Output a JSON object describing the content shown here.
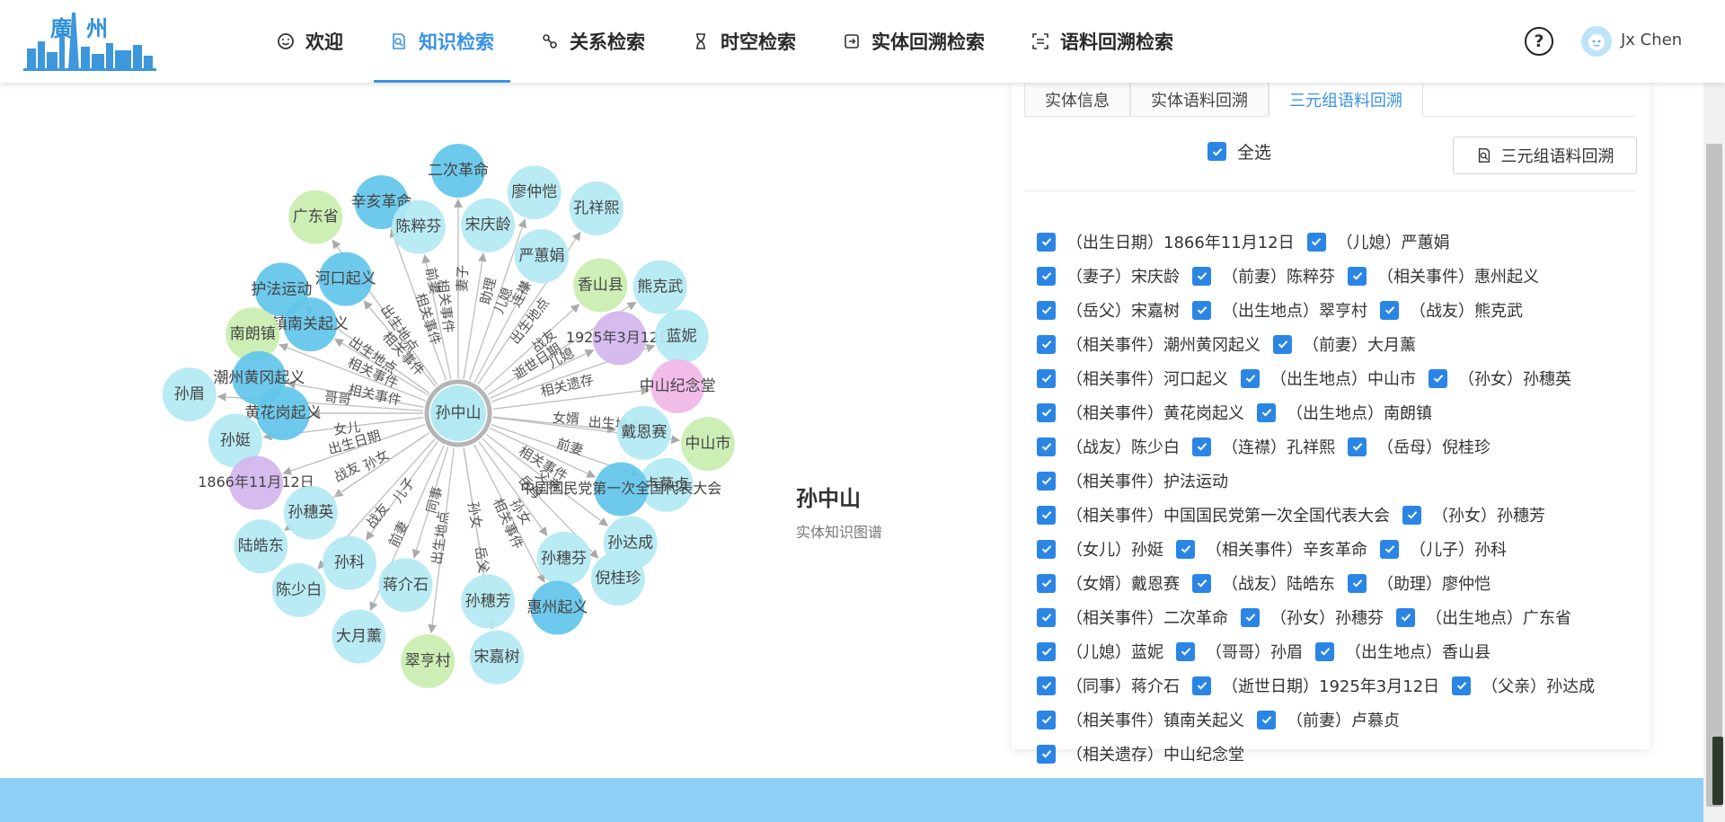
{
  "header": {
    "logo_text": "廣州",
    "nav": [
      {
        "label": "欢迎",
        "icon": "smile-icon",
        "active": false
      },
      {
        "label": "知识检索",
        "icon": "document-search-icon",
        "active": true
      },
      {
        "label": "关系检索",
        "icon": "relation-icon",
        "active": false
      },
      {
        "label": "时空检索",
        "icon": "hourglass-icon",
        "active": false
      },
      {
        "label": "实体回溯检索",
        "icon": "entity-trace-icon",
        "active": false
      },
      {
        "label": "语料回溯检索",
        "icon": "corpus-scan-icon",
        "active": false
      }
    ],
    "help_label": "?",
    "user_name": "Jx Chen"
  },
  "graph": {
    "center": "孙中山",
    "title": "孙中山",
    "subtitle": "实体知识图谱",
    "nodes": [
      {
        "label": "辛亥革命",
        "color": "#62c6ea",
        "angle": -110,
        "r": 250
      },
      {
        "label": "二次革命",
        "color": "#62c6ea",
        "angle": -90,
        "r": 270
      },
      {
        "label": "廖仲恺",
        "color": "#b3e9f3",
        "angle": -71,
        "r": 260
      },
      {
        "label": "孔祥熙",
        "color": "#b3e9f3",
        "angle": -56,
        "r": 275
      },
      {
        "label": "广东省",
        "color": "#c9eeb0",
        "angle": -126,
        "r": 270
      },
      {
        "label": "陈粹芬",
        "color": "#b3e9f3",
        "angle": -102,
        "r": 212
      },
      {
        "label": "宋庆龄",
        "color": "#b3e9f3",
        "angle": -81,
        "r": 212
      },
      {
        "label": "严蕙娟",
        "color": "#b3e9f3",
        "angle": -62,
        "r": 198
      },
      {
        "label": "香山县",
        "color": "#c9eeb0",
        "angle": -42,
        "r": 213
      },
      {
        "label": "熊克武",
        "color": "#b3e9f3",
        "angle": -32,
        "r": 265
      },
      {
        "label": "河口起义",
        "color": "#62c6ea",
        "angle": -130,
        "r": 195
      },
      {
        "label": "护法运动",
        "color": "#62c6ea",
        "angle": -145,
        "r": 240
      },
      {
        "label": "1925年3月12日",
        "color": "#d2b5ee",
        "angle": -25,
        "r": 198,
        "small": true
      },
      {
        "label": "蓝妮",
        "color": "#b3e9f3",
        "angle": -19,
        "r": 263
      },
      {
        "label": "镇南关起义",
        "color": "#62c6ea",
        "angle": -149,
        "r": 192
      },
      {
        "label": "南朗镇",
        "color": "#c9eeb0",
        "angle": -159,
        "r": 245
      },
      {
        "label": "中山纪念堂",
        "color": "#f1b6e7",
        "angle": -7,
        "r": 246
      },
      {
        "label": "潮州黄冈起义",
        "color": "#62c6ea",
        "angle": -170,
        "r": 225
      },
      {
        "label": "孙眉",
        "color": "#b3e9f3",
        "angle": -176,
        "r": 300
      },
      {
        "label": "中山市",
        "color": "#c9eeb0",
        "angle": 7,
        "r": 280
      },
      {
        "label": "黄花岗起义",
        "color": "#62c6ea",
        "angle": 180,
        "r": 195
      },
      {
        "label": "戴恩赛",
        "color": "#b3e9f3",
        "angle": 6,
        "r": 208
      },
      {
        "label": "孙娗",
        "color": "#b3e9f3",
        "angle": 173,
        "r": 250
      },
      {
        "label": "卢慕贞",
        "color": "#b3e9f3",
        "angle": 19,
        "r": 245
      },
      {
        "label": "1866年11月12日",
        "color": "#d2b5ee",
        "angle": 161,
        "r": 238,
        "small": true
      },
      {
        "label": "中国国民党第一次全国代表大会",
        "color": "#62c6ea",
        "angle": 25,
        "r": 200,
        "small": true
      },
      {
        "label": "孙穗英",
        "color": "#b3e9f3",
        "angle": 146,
        "r": 198
      },
      {
        "label": "孙达成",
        "color": "#b3e9f3",
        "angle": 37,
        "r": 240
      },
      {
        "label": "陆皓东",
        "color": "#b3e9f3",
        "angle": 146,
        "r": 265
      },
      {
        "label": "孙科",
        "color": "#b3e9f3",
        "angle": 126,
        "r": 206
      },
      {
        "label": "孙穗芬",
        "color": "#b3e9f3",
        "angle": 54,
        "r": 200
      },
      {
        "label": "倪桂珍",
        "color": "#b3e9f3",
        "angle": 46,
        "r": 256
      },
      {
        "label": "陈少白",
        "color": "#b3e9f3",
        "angle": 132,
        "r": 265
      },
      {
        "label": "蒋介石",
        "color": "#b3e9f3",
        "angle": 107,
        "r": 200
      },
      {
        "label": "孙穗芳",
        "color": "#b3e9f3",
        "angle": 81,
        "r": 212
      },
      {
        "label": "惠州起义",
        "color": "#62c6ea",
        "angle": 63,
        "r": 243
      },
      {
        "label": "大月薰",
        "color": "#b3e9f3",
        "angle": 114,
        "r": 272
      },
      {
        "label": "翠亨村",
        "color": "#c9eeb0",
        "angle": 97,
        "r": 278
      },
      {
        "label": "宋嘉树",
        "color": "#b3e9f3",
        "angle": 81,
        "r": 275
      }
    ],
    "edge_labels": [
      {
        "text": "相关事件",
        "angle": -108,
        "r": 110
      },
      {
        "text": "相关事件",
        "angle": -97,
        "r": 120
      },
      {
        "text": "前妻",
        "angle": -101,
        "r": 150
      },
      {
        "text": "妻子",
        "angle": -88,
        "r": 150
      },
      {
        "text": "助理",
        "angle": -76,
        "r": 140
      },
      {
        "text": "儿媳",
        "angle": -68,
        "r": 135
      },
      {
        "text": "连襟",
        "angle": -62,
        "r": 150
      },
      {
        "text": "出生地点",
        "angle": -52,
        "r": 130
      },
      {
        "text": "战友",
        "angle": -40,
        "r": 125
      },
      {
        "text": "逝世日期",
        "angle": -33,
        "r": 105
      },
      {
        "text": "儿媳",
        "angle": -28,
        "r": 130
      },
      {
        "text": "相关遗存",
        "angle": -14,
        "r": 125
      },
      {
        "text": "出生地点",
        "angle": -125,
        "r": 115
      },
      {
        "text": "相关事件",
        "angle": -133,
        "r": 90
      },
      {
        "text": "出生地点",
        "angle": -146,
        "r": 115
      },
      {
        "text": "相关事件",
        "angle": -155,
        "r": 105
      },
      {
        "text": "相关事件",
        "angle": -168,
        "r": 95
      },
      {
        "text": "哥哥",
        "angle": -173,
        "r": 135
      },
      {
        "text": "女儿",
        "angle": 172,
        "r": 125
      },
      {
        "text": "女婿",
        "angle": 3,
        "r": 120
      },
      {
        "text": "出生地点",
        "angle": 4,
        "r": 175
      },
      {
        "text": "前妻",
        "angle": 17,
        "r": 130
      },
      {
        "text": "出生日期",
        "angle": 164,
        "r": 120
      },
      {
        "text": "战友",
        "angle": 152,
        "r": 140
      },
      {
        "text": "孙女",
        "angle": 150,
        "r": 105
      },
      {
        "text": "相关事件",
        "angle": 31,
        "r": 110
      },
      {
        "text": "父亲",
        "angle": 37,
        "r": 125
      },
      {
        "text": "儿子",
        "angle": 125,
        "r": 105
      },
      {
        "text": "战友",
        "angle": 128,
        "r": 145
      },
      {
        "text": "孙女",
        "angle": 58,
        "r": 130
      },
      {
        "text": "岳母",
        "angle": 46,
        "r": 115
      },
      {
        "text": "前妻",
        "angle": 116,
        "r": 150
      },
      {
        "text": "同事",
        "angle": 105,
        "r": 100
      },
      {
        "text": "出生地点",
        "angle": 98,
        "r": 140
      },
      {
        "text": "孙女",
        "angle": 81,
        "r": 115
      },
      {
        "text": "岳父",
        "angle": 81,
        "r": 165
      },
      {
        "text": "相关事件",
        "angle": 66,
        "r": 135
      }
    ]
  },
  "panel": {
    "tabs": [
      {
        "label": "实体信息",
        "active": false
      },
      {
        "label": "实体语料回溯",
        "active": false
      },
      {
        "label": "三元组语料回溯",
        "active": true
      }
    ],
    "select_all_label": "全选",
    "trace_button_label": "三元组语料回溯",
    "rows": [
      [
        "（出生日期）1866年11月12日",
        "（儿媳）严蕙娟"
      ],
      [
        "（妻子）宋庆龄",
        "（前妻）陈粹芬",
        "（相关事件）惠州起义"
      ],
      [
        "（岳父）宋嘉树",
        "（出生地点）翠亨村",
        "（战友）熊克武"
      ],
      [
        "（相关事件）潮州黄冈起义",
        "（前妻）大月薰"
      ],
      [
        "（相关事件）河口起义",
        "（出生地点）中山市",
        "（孙女）孙穗英"
      ],
      [
        "（相关事件）黄花岗起义",
        "（出生地点）南朗镇"
      ],
      [
        "（战友）陈少白",
        "（连襟）孔祥熙",
        "（岳母）倪桂珍"
      ],
      [
        "（相关事件）护法运动"
      ],
      [
        "（相关事件）中国国民党第一次全国代表大会",
        "（孙女）孙穗芳"
      ],
      [
        "（女儿）孙娗",
        "（相关事件）辛亥革命",
        "（儿子）孙科"
      ],
      [
        "（女婿）戴恩赛",
        "（战友）陆皓东",
        "（助理）廖仲恺"
      ],
      [
        "（相关事件）二次革命",
        "（孙女）孙穗芬",
        "（出生地点）广东省"
      ],
      [
        "（儿媳）蓝妮",
        "（哥哥）孙眉",
        "（出生地点）香山县"
      ],
      [
        "（同事）蒋介石",
        "（逝世日期）1925年3月12日",
        "（父亲）孙达成"
      ],
      [
        "（相关事件）镇南关起义",
        "（前妻）卢慕贞"
      ],
      [
        "（相关遗存）中山纪念堂"
      ]
    ]
  },
  "colors": {
    "accent": "#3a92e3",
    "checkbox": "#2b85e4",
    "footer": "#8fd0f7"
  }
}
